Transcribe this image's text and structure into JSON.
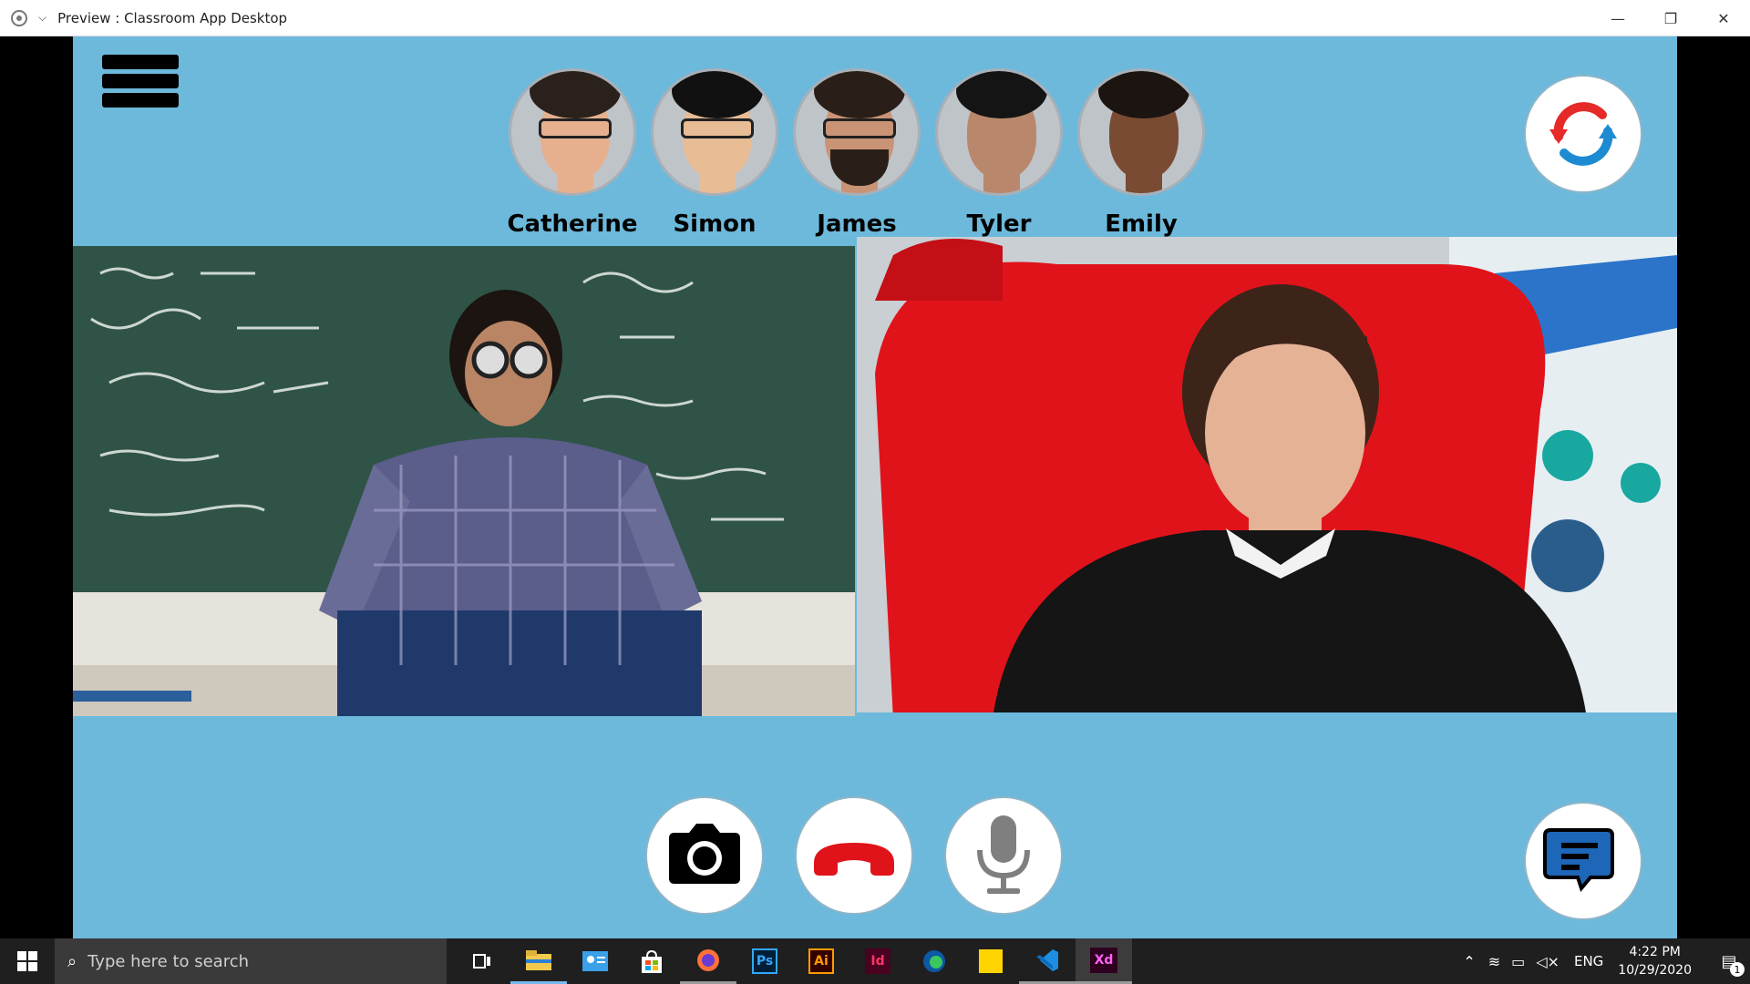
{
  "window": {
    "title": "Preview : Classroom App Desktop"
  },
  "participants": [
    {
      "name": "Catherine",
      "skin": "#e6b08f",
      "hair": "#2b211c",
      "glasses": true
    },
    {
      "name": "Simon",
      "skin": "#e8bc95",
      "hair": "#111111",
      "glasses": true
    },
    {
      "name": "James",
      "skin": "#c99376",
      "hair": "#2a1f18",
      "glasses": true
    },
    {
      "name": "Tyler",
      "skin": "#b9876b",
      "hair": "#141414",
      "glasses": false
    },
    {
      "name": "Emily",
      "skin": "#7a4b33",
      "hair": "#1c1410",
      "glasses": false
    }
  ],
  "colors": {
    "app_background": "#6cb9dc",
    "hangup_red": "#e0131b",
    "mic_gray": "#7f7f7f",
    "chat_blue": "#1d66b8",
    "sync_red": "#e52a28",
    "sync_blue": "#1d8bd1"
  },
  "taskbar": {
    "search_placeholder": "Type here to search",
    "apps": [
      "task-view",
      "file-explorer",
      "contacts",
      "store",
      "firefox",
      "Ps",
      "Ai",
      "Id",
      "edge",
      "sticky-notes",
      "vscode",
      "Xd"
    ],
    "tray_language": "ENG",
    "time": "4:22 PM",
    "date": "10/29/2020",
    "notification_count": "1"
  }
}
